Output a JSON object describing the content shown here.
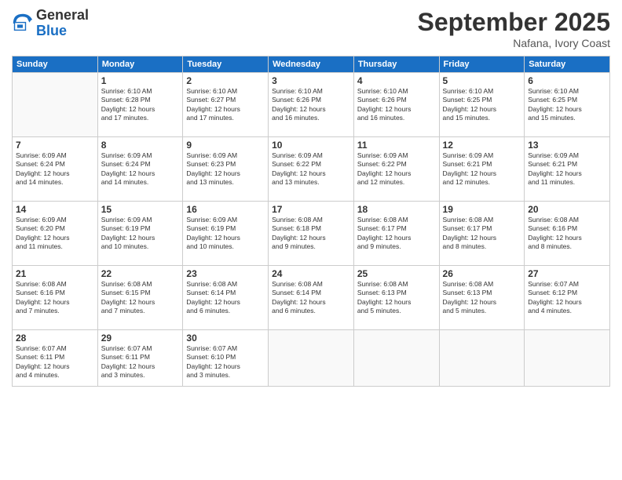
{
  "logo": {
    "general": "General",
    "blue": "Blue"
  },
  "title": "September 2025",
  "location": "Nafana, Ivory Coast",
  "days_of_week": [
    "Sunday",
    "Monday",
    "Tuesday",
    "Wednesday",
    "Thursday",
    "Friday",
    "Saturday"
  ],
  "weeks": [
    [
      {
        "day": "",
        "info": ""
      },
      {
        "day": "1",
        "info": "Sunrise: 6:10 AM\nSunset: 6:28 PM\nDaylight: 12 hours\nand 17 minutes."
      },
      {
        "day": "2",
        "info": "Sunrise: 6:10 AM\nSunset: 6:27 PM\nDaylight: 12 hours\nand 17 minutes."
      },
      {
        "day": "3",
        "info": "Sunrise: 6:10 AM\nSunset: 6:26 PM\nDaylight: 12 hours\nand 16 minutes."
      },
      {
        "day": "4",
        "info": "Sunrise: 6:10 AM\nSunset: 6:26 PM\nDaylight: 12 hours\nand 16 minutes."
      },
      {
        "day": "5",
        "info": "Sunrise: 6:10 AM\nSunset: 6:25 PM\nDaylight: 12 hours\nand 15 minutes."
      },
      {
        "day": "6",
        "info": "Sunrise: 6:10 AM\nSunset: 6:25 PM\nDaylight: 12 hours\nand 15 minutes."
      }
    ],
    [
      {
        "day": "7",
        "info": "Sunrise: 6:09 AM\nSunset: 6:24 PM\nDaylight: 12 hours\nand 14 minutes."
      },
      {
        "day": "8",
        "info": "Sunrise: 6:09 AM\nSunset: 6:24 PM\nDaylight: 12 hours\nand 14 minutes."
      },
      {
        "day": "9",
        "info": "Sunrise: 6:09 AM\nSunset: 6:23 PM\nDaylight: 12 hours\nand 13 minutes."
      },
      {
        "day": "10",
        "info": "Sunrise: 6:09 AM\nSunset: 6:22 PM\nDaylight: 12 hours\nand 13 minutes."
      },
      {
        "day": "11",
        "info": "Sunrise: 6:09 AM\nSunset: 6:22 PM\nDaylight: 12 hours\nand 12 minutes."
      },
      {
        "day": "12",
        "info": "Sunrise: 6:09 AM\nSunset: 6:21 PM\nDaylight: 12 hours\nand 12 minutes."
      },
      {
        "day": "13",
        "info": "Sunrise: 6:09 AM\nSunset: 6:21 PM\nDaylight: 12 hours\nand 11 minutes."
      }
    ],
    [
      {
        "day": "14",
        "info": "Sunrise: 6:09 AM\nSunset: 6:20 PM\nDaylight: 12 hours\nand 11 minutes."
      },
      {
        "day": "15",
        "info": "Sunrise: 6:09 AM\nSunset: 6:19 PM\nDaylight: 12 hours\nand 10 minutes."
      },
      {
        "day": "16",
        "info": "Sunrise: 6:09 AM\nSunset: 6:19 PM\nDaylight: 12 hours\nand 10 minutes."
      },
      {
        "day": "17",
        "info": "Sunrise: 6:08 AM\nSunset: 6:18 PM\nDaylight: 12 hours\nand 9 minutes."
      },
      {
        "day": "18",
        "info": "Sunrise: 6:08 AM\nSunset: 6:17 PM\nDaylight: 12 hours\nand 9 minutes."
      },
      {
        "day": "19",
        "info": "Sunrise: 6:08 AM\nSunset: 6:17 PM\nDaylight: 12 hours\nand 8 minutes."
      },
      {
        "day": "20",
        "info": "Sunrise: 6:08 AM\nSunset: 6:16 PM\nDaylight: 12 hours\nand 8 minutes."
      }
    ],
    [
      {
        "day": "21",
        "info": "Sunrise: 6:08 AM\nSunset: 6:16 PM\nDaylight: 12 hours\nand 7 minutes."
      },
      {
        "day": "22",
        "info": "Sunrise: 6:08 AM\nSunset: 6:15 PM\nDaylight: 12 hours\nand 7 minutes."
      },
      {
        "day": "23",
        "info": "Sunrise: 6:08 AM\nSunset: 6:14 PM\nDaylight: 12 hours\nand 6 minutes."
      },
      {
        "day": "24",
        "info": "Sunrise: 6:08 AM\nSunset: 6:14 PM\nDaylight: 12 hours\nand 6 minutes."
      },
      {
        "day": "25",
        "info": "Sunrise: 6:08 AM\nSunset: 6:13 PM\nDaylight: 12 hours\nand 5 minutes."
      },
      {
        "day": "26",
        "info": "Sunrise: 6:08 AM\nSunset: 6:13 PM\nDaylight: 12 hours\nand 5 minutes."
      },
      {
        "day": "27",
        "info": "Sunrise: 6:07 AM\nSunset: 6:12 PM\nDaylight: 12 hours\nand 4 minutes."
      }
    ],
    [
      {
        "day": "28",
        "info": "Sunrise: 6:07 AM\nSunset: 6:11 PM\nDaylight: 12 hours\nand 4 minutes."
      },
      {
        "day": "29",
        "info": "Sunrise: 6:07 AM\nSunset: 6:11 PM\nDaylight: 12 hours\nand 3 minutes."
      },
      {
        "day": "30",
        "info": "Sunrise: 6:07 AM\nSunset: 6:10 PM\nDaylight: 12 hours\nand 3 minutes."
      },
      {
        "day": "",
        "info": ""
      },
      {
        "day": "",
        "info": ""
      },
      {
        "day": "",
        "info": ""
      },
      {
        "day": "",
        "info": ""
      }
    ]
  ]
}
